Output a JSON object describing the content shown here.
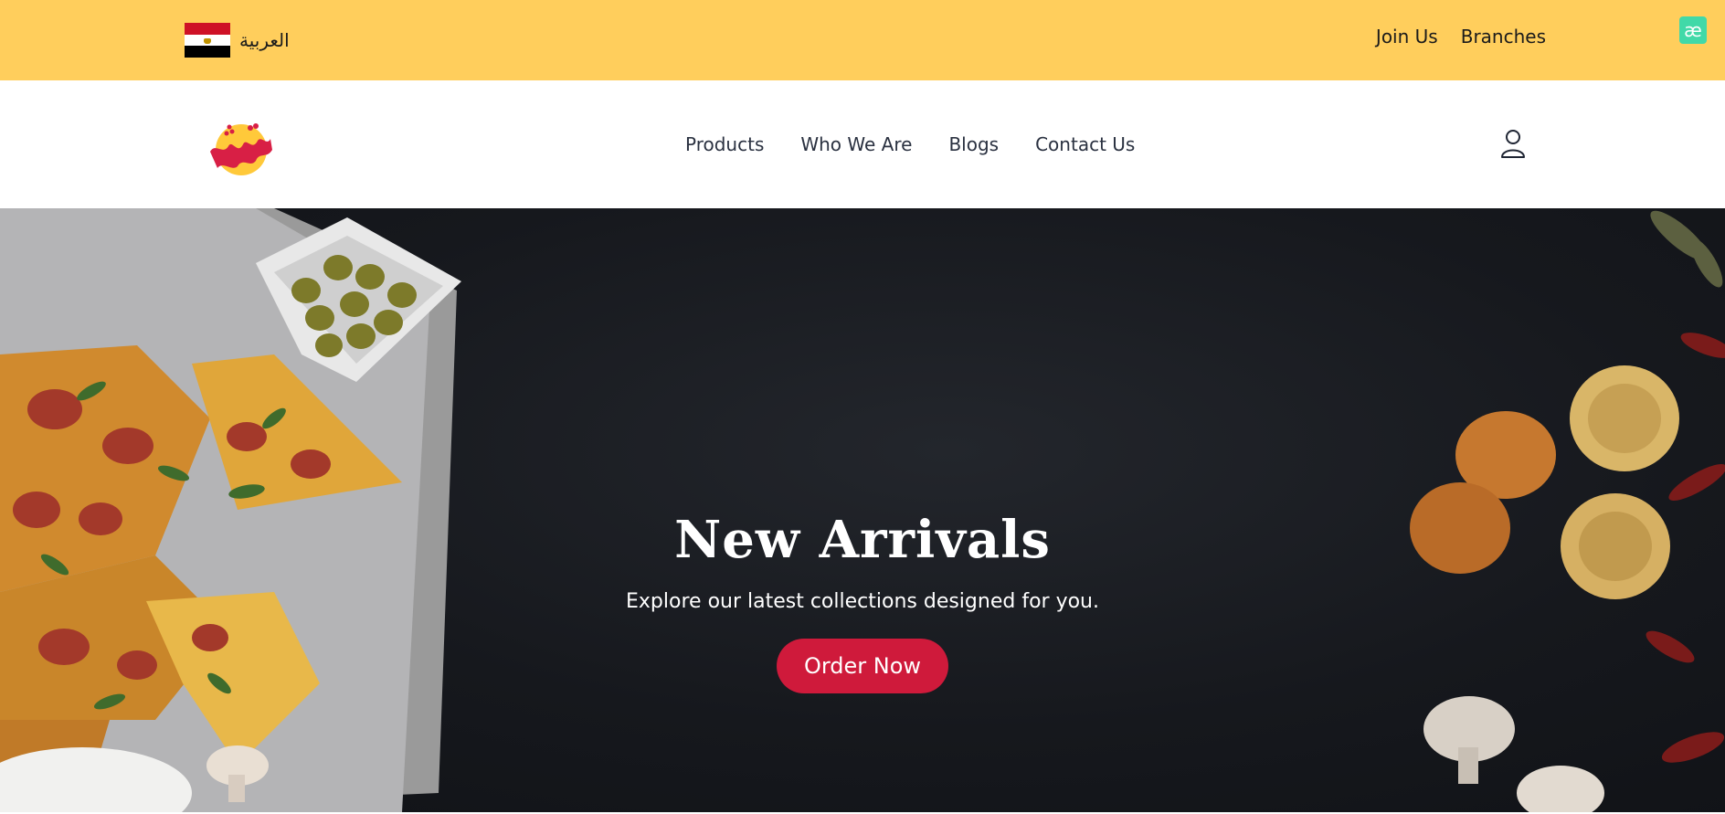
{
  "topbar": {
    "language_label": "العربية",
    "links": [
      "Join Us",
      "Branches"
    ],
    "extension_badge": "æ"
  },
  "header": {
    "logo_alt": "شرق",
    "nav": [
      "Products",
      "Who We Are",
      "Blogs",
      "Contact Us"
    ],
    "user_icon": "user-icon"
  },
  "hero": {
    "title": "New Arrivals",
    "subtitle": "Explore our latest collections designed for you.",
    "cta_label": "Order Now"
  },
  "colors": {
    "topbar_bg": "#ffce5c",
    "accent": "#cf1a3b",
    "hero_bg": "#16181d"
  }
}
